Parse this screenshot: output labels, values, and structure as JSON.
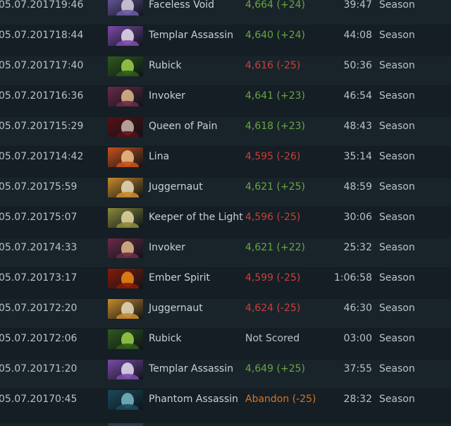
{
  "rows": [
    {
      "date": "05.07.2017",
      "time": "19:46",
      "hero": "Faceless Void",
      "hero_icon": "faceless-void-portrait",
      "mmr": "4,664 (+24)",
      "result": "win",
      "duration": "39:47",
      "mode": "Season",
      "c1": "#6b5aa0",
      "c2": "#d8d2e0"
    },
    {
      "date": "05.07.2017",
      "time": "18:44",
      "hero": "Templar Assassin",
      "hero_icon": "templar-assassin-portrait",
      "mmr": "4,640 (+24)",
      "result": "win",
      "duration": "44:08",
      "mode": "Season",
      "c1": "#7b4aa8",
      "c2": "#e6dff0"
    },
    {
      "date": "05.07.2017",
      "time": "17:40",
      "hero": "Rubick",
      "hero_icon": "rubick-portrait",
      "mmr": "4,616 (-25)",
      "result": "loss",
      "duration": "50:36",
      "mode": "Season",
      "c1": "#2f5a1c",
      "c2": "#9fd24a"
    },
    {
      "date": "05.07.2017",
      "time": "16:36",
      "hero": "Invoker",
      "hero_icon": "invoker-portrait",
      "mmr": "4,641 (+23)",
      "result": "win",
      "duration": "46:54",
      "mode": "Season",
      "c1": "#6a2a48",
      "c2": "#e0bc8a"
    },
    {
      "date": "05.07.2017",
      "time": "15:29",
      "hero": "Queen of Pain",
      "hero_icon": "queen-of-pain-portrait",
      "mmr": "4,618 (+23)",
      "result": "win",
      "duration": "48:43",
      "mode": "Season",
      "c1": "#5a0f14",
      "c2": "#c9b6b0"
    },
    {
      "date": "05.07.2017",
      "time": "14:42",
      "hero": "Lina",
      "hero_icon": "lina-portrait",
      "mmr": "4,595 (-26)",
      "result": "loss",
      "duration": "35:14",
      "mode": "Season",
      "c1": "#c9501a",
      "c2": "#f2c28c"
    },
    {
      "date": "05.07.2017",
      "time": "5:59",
      "hero": "Juggernaut",
      "hero_icon": "juggernaut-portrait",
      "mmr": "4,621 (+25)",
      "result": "win",
      "duration": "48:59",
      "mode": "Season",
      "c1": "#c98a2a",
      "c2": "#e8dcc0"
    },
    {
      "date": "05.07.2017",
      "time": "5:07",
      "hero": "Keeper of the Light",
      "hero_icon": "keeper-of-the-light-portrait",
      "mmr": "4,596 (-25)",
      "result": "loss",
      "duration": "30:06",
      "mode": "Season",
      "c1": "#8a8a3a",
      "c2": "#e8d8a8"
    },
    {
      "date": "05.07.2017",
      "time": "4:33",
      "hero": "Invoker",
      "hero_icon": "invoker-portrait",
      "mmr": "4,621 (+22)",
      "result": "win",
      "duration": "25:32",
      "mode": "Season",
      "c1": "#6a2a48",
      "c2": "#e0bc8a"
    },
    {
      "date": "05.07.2017",
      "time": "3:17",
      "hero": "Ember Spirit",
      "hero_icon": "ember-spirit-portrait",
      "mmr": "4,599 (-25)",
      "result": "loss",
      "duration": "1:06:58",
      "mode": "Season",
      "c1": "#8a1a08",
      "c2": "#f08a1a"
    },
    {
      "date": "05.07.2017",
      "time": "2:20",
      "hero": "Juggernaut",
      "hero_icon": "juggernaut-portrait",
      "mmr": "4,624 (-25)",
      "result": "loss",
      "duration": "46:30",
      "mode": "Season",
      "c1": "#c98a2a",
      "c2": "#e8dcc0"
    },
    {
      "date": "05.07.2017",
      "time": "2:06",
      "hero": "Rubick",
      "hero_icon": "rubick-portrait",
      "mmr": "Not Scored",
      "result": "neutral",
      "duration": "03:00",
      "mode": "Season",
      "c1": "#2f5a1c",
      "c2": "#9fd24a"
    },
    {
      "date": "05.07.2017",
      "time": "1:20",
      "hero": "Templar Assassin",
      "hero_icon": "templar-assassin-portrait",
      "mmr": "4,649 (+25)",
      "result": "win",
      "duration": "37:55",
      "mode": "Season",
      "c1": "#7b4aa8",
      "c2": "#e6dff0"
    },
    {
      "date": "05.07.2017",
      "time": "0:45",
      "hero": "Phantom Assassin",
      "hero_icon": "phantom-assassin-portrait",
      "mmr": "Abandon (-25)",
      "result": "abandon",
      "duration": "28:32",
      "mode": "Season",
      "c1": "#1a4a5a",
      "c2": "#7ab8c8"
    }
  ]
}
